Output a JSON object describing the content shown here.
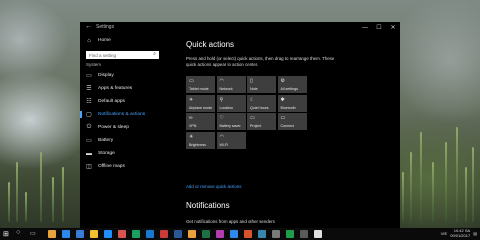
{
  "window": {
    "title": "Settings",
    "back_icon": "←",
    "minimize": "—",
    "maximize": "☐",
    "close": "✕"
  },
  "sidebar": {
    "home": {
      "label": "Home",
      "icon": "⌂"
    },
    "search_placeholder": "Find a setting",
    "search_icon": "⌕",
    "group": "System",
    "items": [
      {
        "label": "Display",
        "icon": "▭"
      },
      {
        "label": "Apps & features",
        "icon": "☰"
      },
      {
        "label": "Default apps",
        "icon": "☷"
      },
      {
        "label": "Notifications & actions",
        "icon": "▢"
      },
      {
        "label": "Power & sleep",
        "icon": "⏻"
      },
      {
        "label": "Battery",
        "icon": "▭"
      },
      {
        "label": "Storage",
        "icon": "▬"
      },
      {
        "label": "Offline maps",
        "icon": "◫"
      }
    ],
    "active_index": 3
  },
  "main": {
    "quick_actions_title": "Quick actions",
    "quick_actions_desc": "Press and hold (or select) quick actions, then drag to rearrange them. These quick actions appear in action center.",
    "tiles": [
      {
        "label": "Tablet mode",
        "icon": "▭"
      },
      {
        "label": "Network",
        "icon": "◠"
      },
      {
        "label": "Note",
        "icon": "▯"
      },
      {
        "label": "All settings",
        "icon": "⚙"
      },
      {
        "label": "Airplane mode",
        "icon": "✈"
      },
      {
        "label": "Location",
        "icon": "⚲"
      },
      {
        "label": "Quiet hours",
        "icon": "☾"
      },
      {
        "label": "Bluetooth",
        "icon": "✱"
      },
      {
        "label": "VPN",
        "icon": "∞"
      },
      {
        "label": "Battery saver",
        "icon": "♡"
      },
      {
        "label": "Project",
        "icon": "▭"
      },
      {
        "label": "Connect",
        "icon": "▭"
      },
      {
        "label": "Brightness",
        "icon": "☀"
      },
      {
        "label": "Wi-Fi",
        "icon": "◠"
      }
    ],
    "add_remove_link": "Add or remove quick actions",
    "notifications_title": "Notifications",
    "notifications_desc": "Get notifications from apps and other senders"
  },
  "taskbar": {
    "start_icon": "⊞",
    "search_icon": "○",
    "task_view_icon": "▭",
    "app_colors": [
      "#e8a33a",
      "#2d89ef",
      "#3a7bd5",
      "#f2c12e",
      "#1e90ff",
      "#d9534f",
      "#1aa15f",
      "#1778d2",
      "#cc3a3a",
      "#2b5797",
      "#e8a33a",
      "#1e7145",
      "#b23cb0",
      "#2d89ef",
      "#da532c",
      "#3a87ad",
      "#7a7a7a",
      "#1d9e4a",
      "#5a5a5a",
      "#e0e0e0"
    ],
    "language": "VIE",
    "time": "10:42 SA",
    "date": "09/01/2017"
  },
  "colors": {
    "accent": "#4aa3ff",
    "window_bg": "#000000",
    "tile_bg": "#3e3e3e"
  }
}
